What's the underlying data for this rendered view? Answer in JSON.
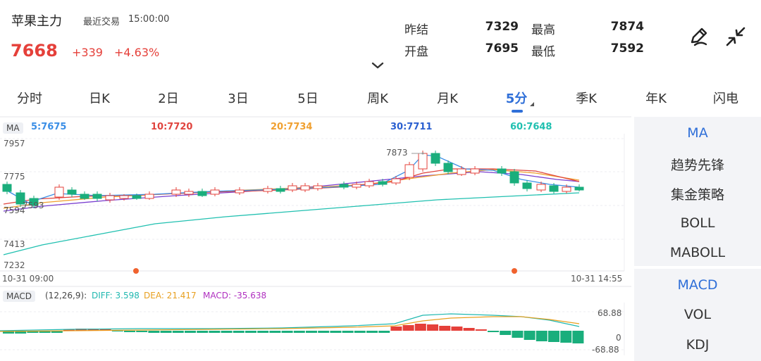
{
  "header": {
    "title": "苹果主力",
    "recent_label": "最近交易",
    "time": "15:00:00",
    "price": "7668",
    "change": "+339",
    "change_pct": "+4.63%",
    "stats": {
      "prev_settle_label": "昨结",
      "prev_settle": "7329",
      "high_label": "最高",
      "high": "7874",
      "open_label": "开盘",
      "open": "7695",
      "low_label": "最低",
      "low": "7592"
    }
  },
  "tabs": [
    "分时",
    "日K",
    "2日",
    "3日",
    "5日",
    "周K",
    "月K",
    "5分",
    "季K",
    "年K",
    "闪电"
  ],
  "active_tab": "5分",
  "indicators": {
    "main_badge": "MA",
    "ma5": "5:7675",
    "ma10": "10:7720",
    "ma20": "20:7734",
    "ma30": "30:7711",
    "ma60": "60:7648",
    "y_labels": [
      "7957",
      "7775",
      "7594",
      "7413",
      "7232"
    ],
    "start_time": "10-31 09:00",
    "end_time": "10-31 14:55",
    "high_mark": "7873",
    "low_mark": "7593"
  },
  "macd": {
    "badge": "MACD",
    "params": "(12,26,9):",
    "diff": "DIFF: 3.598",
    "dea": "DEA: 21.417",
    "macd": "MACD: -35.638",
    "y_top": "68.88",
    "y_zero": "0",
    "y_bottom": "-68.88"
  },
  "side_panel": {
    "main": [
      "MA",
      "趋势先锋",
      "集金策略",
      "BOLL",
      "MABOLL"
    ],
    "sub": [
      "MACD",
      "VOL",
      "KDJ"
    ]
  },
  "colors": {
    "up": "#e5403a",
    "down": "#1aae7c",
    "accent": "#2f6fd8",
    "ma5": "#3a8ee6",
    "ma10": "#e0443e",
    "ma20": "#f0a030",
    "ma30": "#2a5fd0",
    "ma60": "#20c0b0",
    "ma_purple": "#7a3fd0"
  },
  "icons": {
    "edit": "pen-icon",
    "collapse": "collapse-arrows-icon",
    "expand": "chevron-down-icon"
  }
}
